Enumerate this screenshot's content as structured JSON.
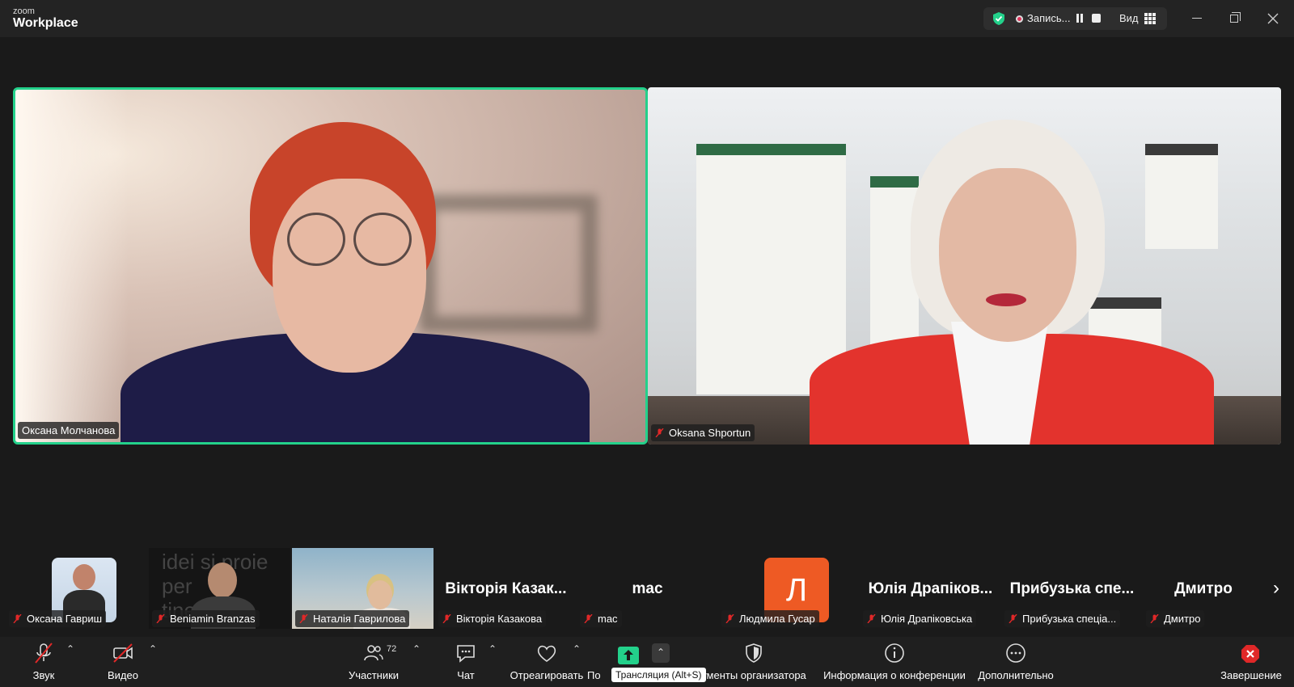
{
  "app": {
    "brand_small": "zoom",
    "brand_big": "Workplace"
  },
  "header": {
    "recording_label": "Запись...",
    "view_label": "Вид",
    "icons": [
      "shield-check-icon",
      "record-dot-icon",
      "pause-icon",
      "stop-icon",
      "grid-view-icon",
      "minimize-icon",
      "restore-icon",
      "close-icon"
    ]
  },
  "main_tiles": [
    {
      "name": "Оксана Молчанова",
      "active_speaker": true,
      "muted": false
    },
    {
      "name": "Oksana Shportun",
      "active_speaker": false,
      "muted": true
    }
  ],
  "gallery": [
    {
      "name": "Оксана Гавриш",
      "kind": "avatar-photo",
      "muted": true
    },
    {
      "name": "Beniamin Branzas",
      "kind": "video",
      "background_text": "idei si proie\nper\ntine ectiv",
      "muted": true
    },
    {
      "name": "Наталія Гаврилова",
      "kind": "video",
      "muted": true
    },
    {
      "name": "Вікторія Казакова",
      "big_name": "Вікторія Казак...",
      "kind": "name-only",
      "muted": true
    },
    {
      "name": "mac",
      "big_name": "mac",
      "kind": "name-only",
      "muted": true
    },
    {
      "name": "Людмила Гусар",
      "kind": "letter",
      "letter": "Л",
      "muted": true
    },
    {
      "name": "Юлія Драпіковська",
      "big_name": "Юлія Драпіков...",
      "kind": "name-only",
      "muted": true
    },
    {
      "name": "Прибузька спеціа...",
      "big_name": "Прибузька спе...",
      "kind": "name-only",
      "muted": true
    },
    {
      "name": "Дмитро",
      "big_name": "Дмитро",
      "kind": "name-only",
      "muted": true
    }
  ],
  "gallery_next_icon": "chevron-right-icon",
  "toolbar": {
    "audio": "Звук",
    "video": "Видео",
    "participants": "Участники",
    "participants_count": "72",
    "chat": "Чат",
    "react": "Отреагировать",
    "share_partial": "По",
    "host_tools_partial": "ументы организатора",
    "meeting_info": "Информация о конференции",
    "more": "Дополнительно",
    "end": "Завершение",
    "share_tooltip": "Трансляция (Alt+S)"
  },
  "colors": {
    "active_speaker": "#23d18b",
    "share": "#23d18b",
    "end": "#e02828",
    "mute_slash": "#e02828",
    "letter_avatar": "#ee5a24"
  }
}
